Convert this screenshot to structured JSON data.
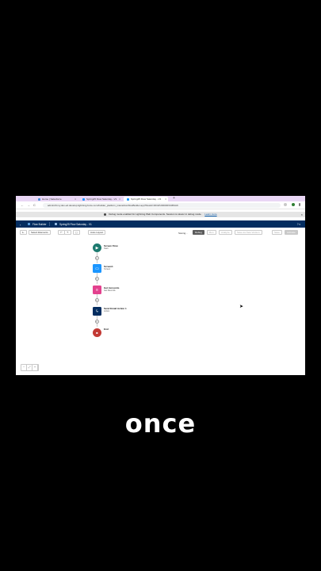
{
  "browser": {
    "tabs": [
      {
        "label": "Home | Salesforce",
        "active": false,
        "color": "#4a90d9"
      },
      {
        "label": "Spring25 Flow Saturday - V1",
        "active": false,
        "color": "#1b96ff"
      },
      {
        "label": "Spring25 Flow Saturday - V1",
        "active": true,
        "color": "#1b96ff"
      }
    ],
    "new_tab": "+",
    "back": "←",
    "forward": "→",
    "reload": "C",
    "url": "admin20.my.dev-ed.develop.lightning.force.com/builder_platform_interaction/flowBuilder.app?flowId=301WU00000Vb0BJAK"
  },
  "banner": {
    "text": "Debug mode enabled for Lightning Web Components. Session is slower in debug mode.",
    "link": "Learn more",
    "close": "×"
  },
  "header": {
    "back": "‹",
    "app_name": "Flow Builder",
    "flow_name": "Spring25 Flow Saturday - V1",
    "help": "? ▾"
  },
  "toolbar": {
    "select_elements": "Select Elements",
    "undo": "↶",
    "redo": "↷",
    "cut": "▢",
    "layout": "Auto-Layout",
    "saving": "Saving...",
    "debug": "Debug",
    "run": "Run",
    "analyze": "Analyze",
    "save_as_new": "Save as New Version",
    "save": "Save",
    "activate": "Activate"
  },
  "flow_nodes": [
    {
      "label": "Screen Flow",
      "sub": "Start",
      "icon": "play-icon",
      "color": "#1d7a6f",
      "glyph": "▶"
    },
    {
      "label": "Screen1",
      "sub": "Screen",
      "icon": "screen-icon",
      "color": "#1b96ff",
      "glyph": "▭"
    },
    {
      "label": "Get Accounts",
      "sub": "Get Records",
      "icon": "get-records-icon",
      "color": "#e3418e",
      "glyph": "≡"
    },
    {
      "label": "Send Email Action 1",
      "sub": "Action",
      "icon": "lightning-icon",
      "color": "#032d60",
      "glyph": "ϟ"
    },
    {
      "label": "End",
      "sub": "",
      "icon": "stop-icon",
      "color": "#c23934",
      "glyph": "■"
    }
  ],
  "zoom_controls": [
    "−",
    "⤢",
    "+"
  ],
  "caption": "once"
}
